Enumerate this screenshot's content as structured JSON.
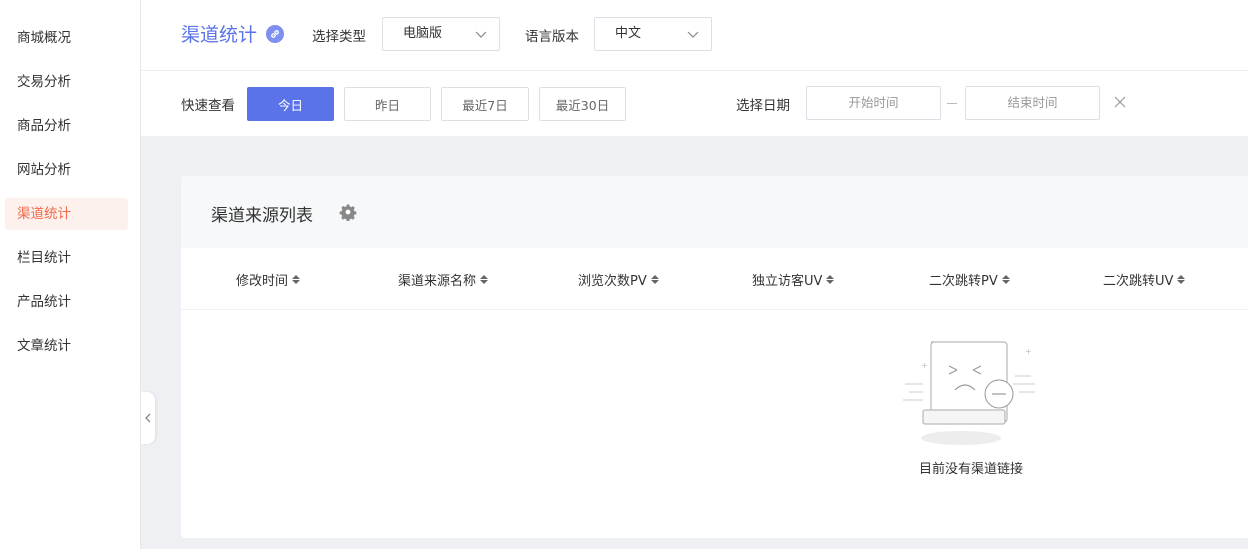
{
  "sidebar": {
    "items": [
      {
        "label": "商城概况"
      },
      {
        "label": "交易分析"
      },
      {
        "label": "商品分析"
      },
      {
        "label": "网站分析"
      },
      {
        "label": "渠道统计",
        "active": true
      },
      {
        "label": "栏目统计"
      },
      {
        "label": "产品统计"
      },
      {
        "label": "文章统计"
      }
    ]
  },
  "header": {
    "title": "渠道统计",
    "type_label": "选择类型",
    "type_value": "电脑版",
    "lang_label": "语言版本",
    "lang_value": "中文"
  },
  "filter": {
    "quick_label": "快速查看",
    "buttons": [
      "今日",
      "昨日",
      "最近7日",
      "最近30日"
    ],
    "date_label": "选择日期",
    "start_placeholder": "开始时间",
    "end_placeholder": "结束时间"
  },
  "card": {
    "title": "渠道来源列表",
    "columns": [
      "修改时间",
      "渠道来源名称",
      "浏览次数PV",
      "独立访客UV",
      "二次跳转PV",
      "二次跳转UV"
    ],
    "empty_text": "目前没有渠道链接"
  },
  "colors": {
    "accent": "#5b73e8",
    "active_text": "#f06a4a",
    "active_bg": "#fdf1ee"
  }
}
